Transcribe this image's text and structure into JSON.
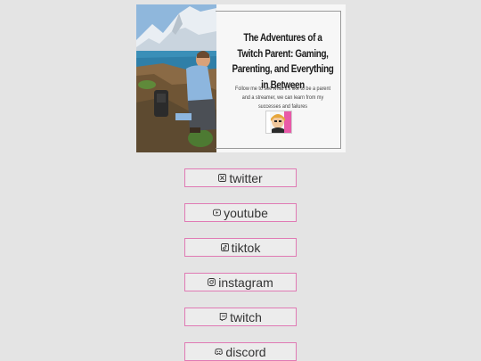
{
  "header": {
    "title": "The Adventures of a Twitch Parent: Gaming, Parenting, and Everything in Between",
    "description": "Follow me to see what it's like to be a parent and a streamer, we can learn from my successes and failures"
  },
  "colors": {
    "button_border": "#e07ab4",
    "page_background": "#e4e4e4"
  },
  "links": [
    {
      "label": "twitter",
      "icon": "x-icon"
    },
    {
      "label": "youtube",
      "icon": "youtube-icon"
    },
    {
      "label": "tiktok",
      "icon": "tiktok-icon"
    },
    {
      "label": "instagram",
      "icon": "instagram-icon"
    },
    {
      "label": "twitch",
      "icon": "twitch-icon"
    },
    {
      "label": "discord",
      "icon": "discord-icon"
    }
  ]
}
